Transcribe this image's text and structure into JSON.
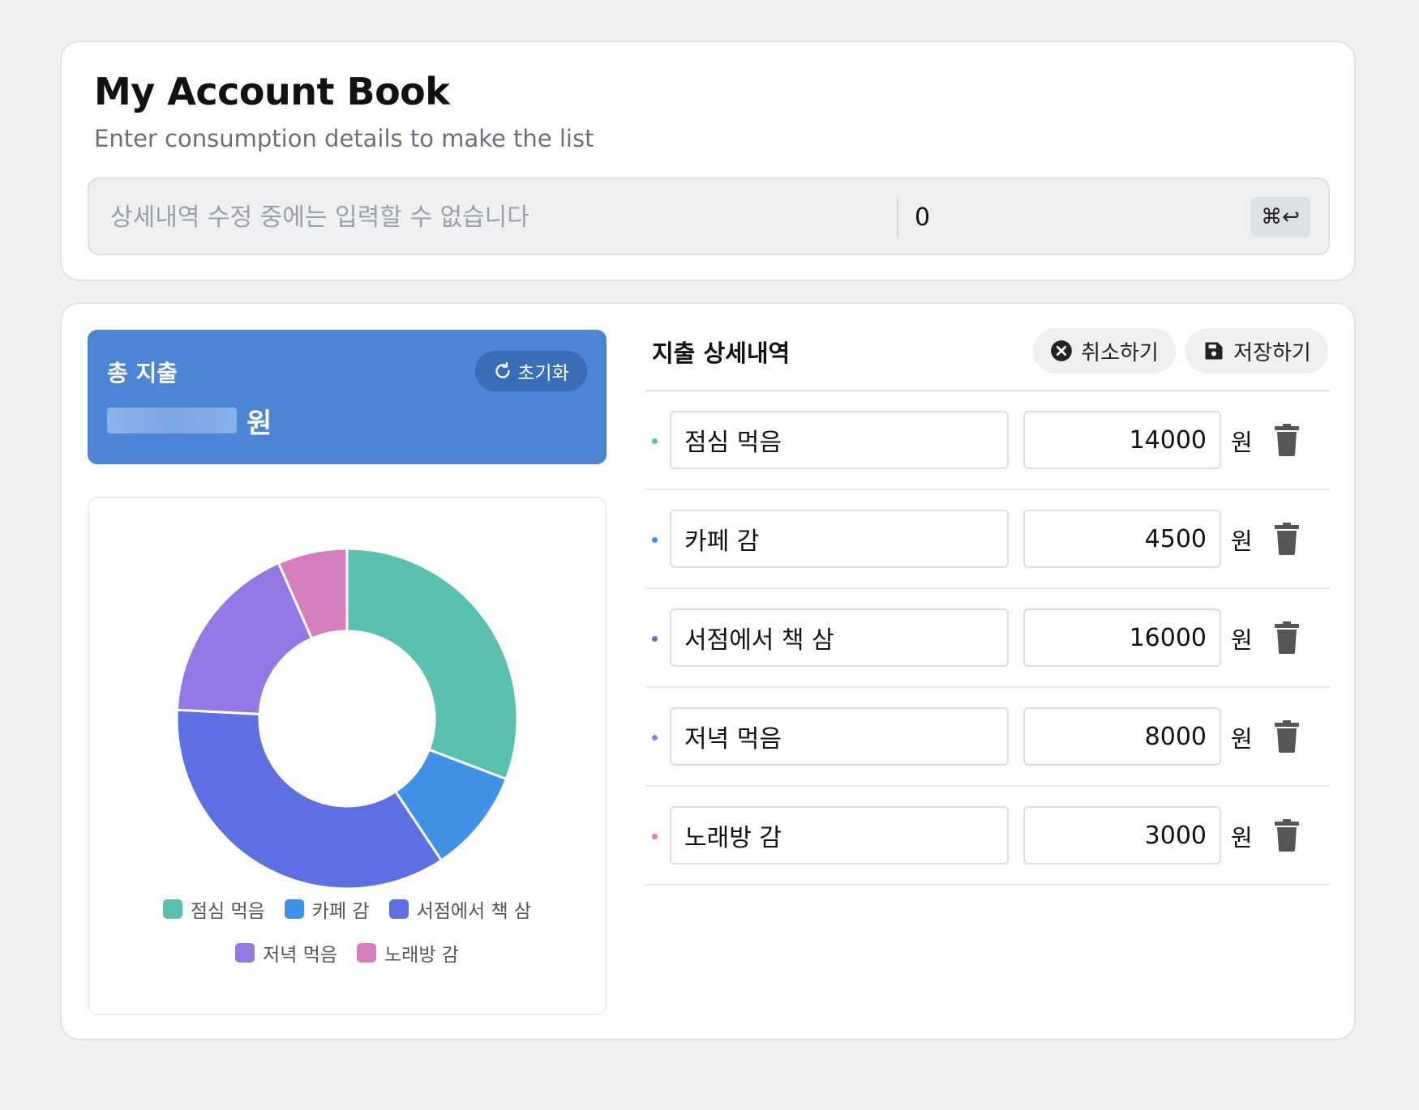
{
  "header": {
    "title": "My Account Book",
    "subtitle": "Enter consumption details to make the list",
    "entry": {
      "description_placeholder": "상세내역 수정 중에는 입력할 수 없습니다",
      "amount_value": "0",
      "submit_key": "⌘↩"
    }
  },
  "total": {
    "label": "총 지출",
    "unit": "원",
    "reset_label": "초기화"
  },
  "details": {
    "title": "지출 상세내역",
    "cancel_label": "취소하기",
    "save_label": "저장하기",
    "unit": "원",
    "items": [
      {
        "description": "점심 먹음",
        "amount": "14000"
      },
      {
        "description": "카페 감",
        "amount": "4500"
      },
      {
        "description": "서점에서 책 삼",
        "amount": "16000"
      },
      {
        "description": "저녁 먹음",
        "amount": "8000"
      },
      {
        "description": "노래방 감",
        "amount": "3000"
      }
    ]
  },
  "chart_data": {
    "type": "pie",
    "categories": [
      "점심 먹음",
      "카페 감",
      "서점에서 책 삼",
      "저녁 먹음",
      "노래방 감"
    ],
    "values": [
      14000,
      4500,
      16000,
      8000,
      3000
    ],
    "colors": [
      "#5bc0b0",
      "#4192e6",
      "#5e6fe1",
      "#9479e5",
      "#d67ebe"
    ],
    "legend": "bottom"
  }
}
